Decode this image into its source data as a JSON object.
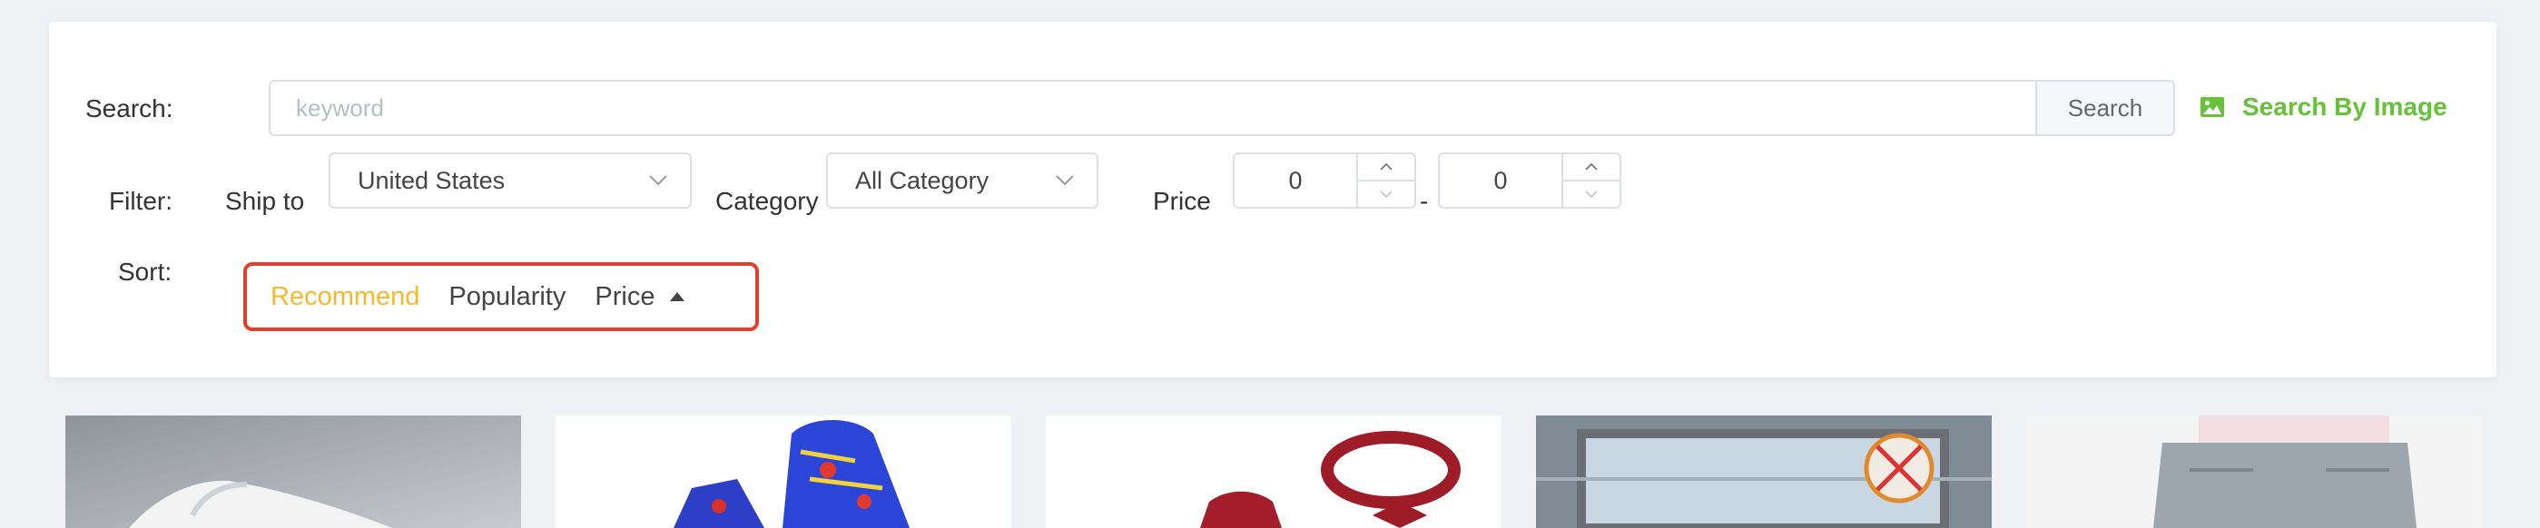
{
  "search": {
    "label": "Search:",
    "placeholder": "keyword",
    "value": "",
    "button_label": "Search",
    "image_search_label": "Search By Image"
  },
  "filter": {
    "label": "Filter:",
    "ship_to_label": "Ship to",
    "ship_to_value": "United States",
    "category_label": "Category",
    "category_value": "All Category",
    "price_label": "Price",
    "price_min": "0",
    "price_separator": "-",
    "price_max": "0"
  },
  "sort": {
    "label": "Sort:",
    "options": [
      "Recommend",
      "Popularity",
      "Price"
    ],
    "active": "Recommend",
    "price_direction": "ascending"
  },
  "colors": {
    "accent_green": "#67c23a",
    "sort_active": "#f5b82e",
    "highlight_border": "#e2402c"
  },
  "products": [
    {
      "image": "white shoe"
    },
    {
      "image": "blue spider-hero pajama set"
    },
    {
      "image": "red knit dress with bow headband"
    },
    {
      "image": "window screen with anti-mosquito badge"
    },
    {
      "image": "denim shorts"
    }
  ]
}
